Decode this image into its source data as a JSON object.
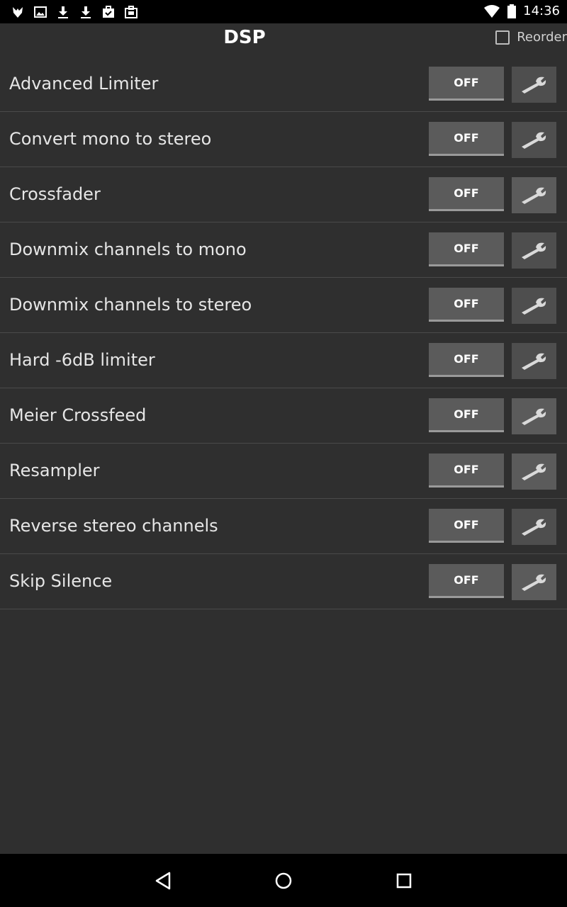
{
  "statusbar": {
    "time": "14:36",
    "left_icons": [
      "app-icon",
      "image-icon",
      "download-icon",
      "download-icon",
      "briefcase-check-icon",
      "briefcase-icon"
    ],
    "right_icons": [
      "wifi-icon",
      "battery-icon"
    ]
  },
  "header": {
    "title": "DSP",
    "reorder_label": "Reorder",
    "reorder_checked": false
  },
  "dsp_items": [
    {
      "label": "Advanced Limiter",
      "toggle": "OFF",
      "icon": "wrench-icon"
    },
    {
      "label": "Convert mono to stereo",
      "toggle": "OFF",
      "icon": "wrench-icon"
    },
    {
      "label": "Crossfader",
      "toggle": "OFF",
      "icon": "wrench-icon"
    },
    {
      "label": "Downmix channels to mono",
      "toggle": "OFF",
      "icon": "wrench-icon"
    },
    {
      "label": "Downmix channels to stereo",
      "toggle": "OFF",
      "icon": "wrench-icon"
    },
    {
      "label": "Hard -6dB limiter",
      "toggle": "OFF",
      "icon": "wrench-icon"
    },
    {
      "label": "Meier Crossfeed",
      "toggle": "OFF",
      "icon": "wrench-icon"
    },
    {
      "label": "Resampler",
      "toggle": "OFF",
      "icon": "wrench-icon"
    },
    {
      "label": "Reverse stereo channels",
      "toggle": "OFF",
      "icon": "wrench-icon"
    },
    {
      "label": "Skip Silence",
      "toggle": "OFF",
      "icon": "wrench-icon"
    }
  ],
  "navbar": {
    "buttons": [
      "back-icon",
      "home-icon",
      "recents-icon"
    ]
  },
  "colors": {
    "background": "#2f2f2f",
    "statusbar": "#000000",
    "toggle_off": "#5b5b5b",
    "text": "#e6e6e6"
  }
}
